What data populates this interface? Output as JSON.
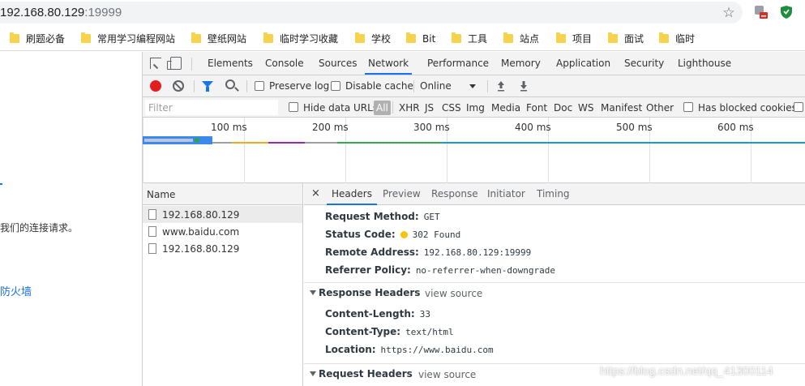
{
  "address": {
    "host": "192.168.80.129",
    "port": ":19999"
  },
  "bookmarks": [
    "刷题必备",
    "常用学习编程网站",
    "壁纸网站",
    "临时学习收藏",
    "学校",
    "Bit",
    "工具",
    "站点",
    "项目",
    "面试",
    "临时"
  ],
  "page": {
    "text": "我们的连接请求。",
    "link": "防火墙"
  },
  "devtools": {
    "tabs": [
      "Elements",
      "Console",
      "Sources",
      "Network",
      "Performance",
      "Memory",
      "Application",
      "Security",
      "Lighthouse"
    ],
    "active_tab": "Network",
    "toolbar": {
      "preserve_log": "Preserve log",
      "disable_cache": "Disable cache",
      "throttle": "Online"
    },
    "filter": {
      "placeholder": "Filter",
      "hide_data_urls": "Hide data URLs",
      "types": [
        "All",
        "XHR",
        "JS",
        "CSS",
        "Img",
        "Media",
        "Font",
        "Doc",
        "WS",
        "Manifest",
        "Other"
      ],
      "blocked": "Has blocked cookies"
    },
    "timeline": {
      "ticks": [
        "100 ms",
        "200 ms",
        "300 ms",
        "400 ms",
        "500 ms",
        "600 ms"
      ]
    },
    "requests": {
      "header": "Name",
      "rows": [
        "192.168.80.129",
        "www.baidu.com",
        "192.168.80.129"
      ]
    },
    "detail": {
      "tabs": [
        "Headers",
        "Preview",
        "Response",
        "Initiator",
        "Timing"
      ],
      "close": "×",
      "general": [
        {
          "key": "Request Method:",
          "val": "GET"
        },
        {
          "key": "Status Code:",
          "val": "302 Found"
        },
        {
          "key": "Remote Address:",
          "val": "192.168.80.129:19999"
        },
        {
          "key": "Referrer Policy:",
          "val": "no-referrer-when-downgrade"
        }
      ],
      "response_headers": {
        "title": "Response Headers",
        "view_source": "view source",
        "items": [
          {
            "key": "Content-Length:",
            "val": "33"
          },
          {
            "key": "Content-Type:",
            "val": "text/html"
          },
          {
            "key": "Location:",
            "val": "https://www.baidu.com"
          }
        ]
      },
      "request_headers": {
        "title": "Request Headers",
        "view_source": "view source"
      }
    }
  },
  "watermark": "https://blog.csdn.net/qq_41300114"
}
